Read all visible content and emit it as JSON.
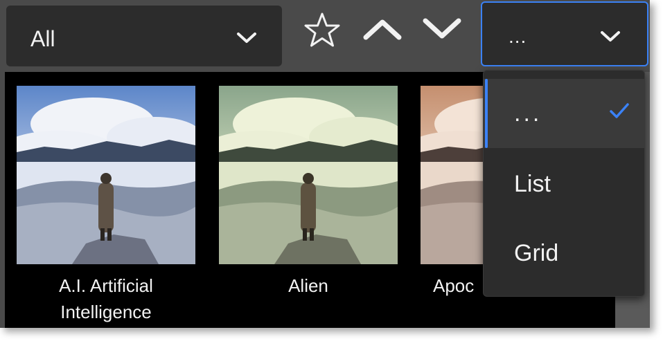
{
  "toolbar": {
    "filter": {
      "value": "All"
    },
    "view": {
      "value": "..."
    }
  },
  "tiles": [
    {
      "title_lines": [
        "A.I. Artificial",
        "Intelligence"
      ],
      "tint": "#b9c7e6"
    },
    {
      "title_lines": [
        "Alien",
        ""
      ],
      "tint": "#c8d9b0"
    },
    {
      "title_lines": [
        "Apoc",
        ""
      ],
      "tint": "#e2b99a"
    }
  ],
  "view_menu": {
    "items": [
      {
        "label": "...",
        "selected": true
      },
      {
        "label": "List",
        "selected": false
      },
      {
        "label": "Grid",
        "selected": false
      }
    ]
  },
  "colors": {
    "accent": "#3b82f6",
    "panel": "#2c2c2c",
    "toolbar": "#4a4a4a"
  },
  "icons": [
    "chevron-down-icon",
    "star-icon",
    "chevron-up-icon",
    "check-icon"
  ]
}
